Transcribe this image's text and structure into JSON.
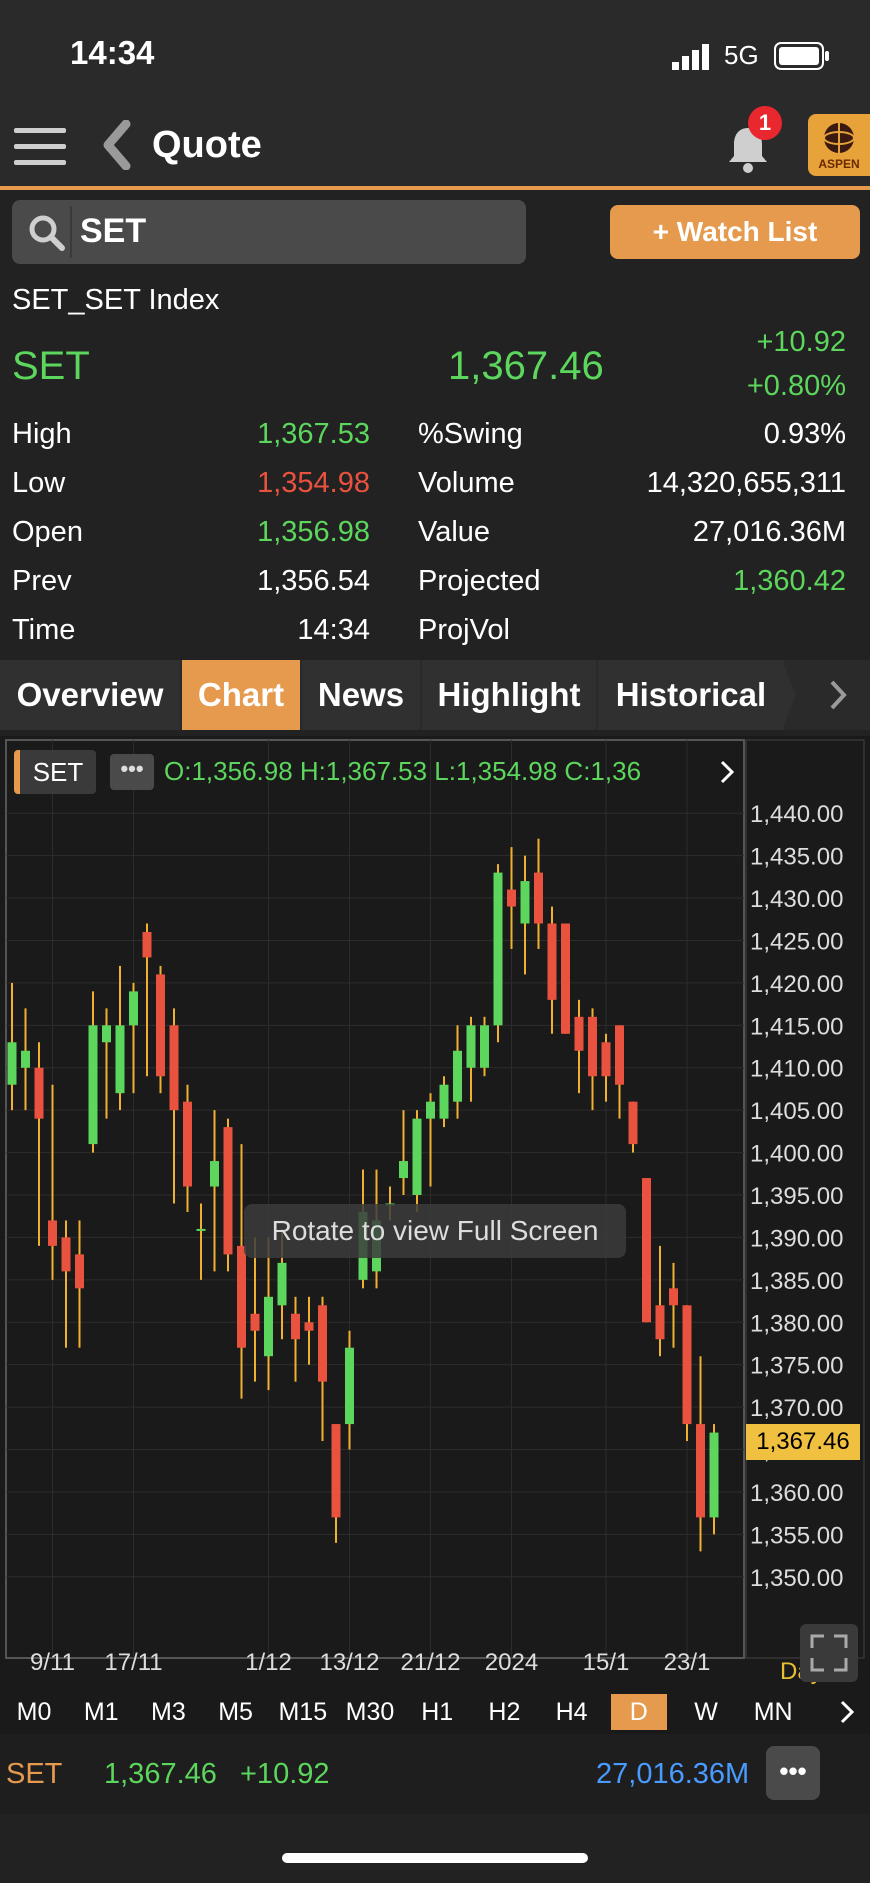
{
  "status_bar": {
    "time": "14:34",
    "network": "5G"
  },
  "header": {
    "title": "Quote",
    "notification_count": "1",
    "logo_text": "ASPEN"
  },
  "search": {
    "value": "SET"
  },
  "watchlist_button": "+ Watch List",
  "quote": {
    "full_name": "SET_SET Index",
    "symbol": "SET",
    "last": "1,367.46",
    "change": "+10.92",
    "change_pct": "+0.80%",
    "fields_left": [
      {
        "label": "High",
        "value": "1,367.53",
        "color": "#5cd65c"
      },
      {
        "label": "Low",
        "value": "1,354.98",
        "color": "#e8523e"
      },
      {
        "label": "Open",
        "value": "1,356.98",
        "color": "#5cd65c"
      },
      {
        "label": "Prev",
        "value": "1,356.54",
        "color": "#ffffff"
      },
      {
        "label": "Time",
        "value": "14:34",
        "color": "#ffffff"
      }
    ],
    "fields_right": [
      {
        "label": "%Swing",
        "value": "0.93%",
        "color": "#ffffff"
      },
      {
        "label": "Volume",
        "value": "14,320,655,311",
        "color": "#ffffff"
      },
      {
        "label": "Value",
        "value": "27,016.36M",
        "color": "#ffffff"
      },
      {
        "label": "Projected",
        "value": "1,360.42",
        "color": "#5cd65c"
      },
      {
        "label": "ProjVol",
        "value": "",
        "color": "#ffffff"
      }
    ]
  },
  "tabs": [
    {
      "label": "Overview",
      "active": false
    },
    {
      "label": "Chart",
      "active": true
    },
    {
      "label": "News",
      "active": false
    },
    {
      "label": "Highlight",
      "active": false
    },
    {
      "label": "Historical",
      "active": false
    }
  ],
  "chart": {
    "symbol_tag": "SET",
    "ohlc_text": "O:1,356.98  H:1,367.53  L:1,354.98  C:1,36",
    "overlay": "Rotate to view Full Screen",
    "period_label": "Day",
    "last_price_label": "1,367.46"
  },
  "chart_data": {
    "type": "candlestick",
    "y_ticks": [
      "1,440.00",
      "1,435.00",
      "1,430.00",
      "1,425.00",
      "1,420.00",
      "1,415.00",
      "1,410.00",
      "1,405.00",
      "1,400.00",
      "1,395.00",
      "1,390.00",
      "1,385.00",
      "1,380.00",
      "1,375.00",
      "1,370.00",
      "1,365.00",
      "1,360.00",
      "1,355.00",
      "1,350.00"
    ],
    "ylim": [
      1347.5,
      1442.5
    ],
    "x_tick_labels": [
      {
        "label": "9/11",
        "index": 3
      },
      {
        "label": "17/11",
        "index": 9
      },
      {
        "label": "1/12",
        "index": 19
      },
      {
        "label": "13/12",
        "index": 25
      },
      {
        "label": "21/12",
        "index": 31
      },
      {
        "label": "2024",
        "index": 37
      },
      {
        "label": "15/1",
        "index": 44
      },
      {
        "label": "23/1",
        "index": 50
      }
    ],
    "candles": [
      {
        "o": 1408,
        "h": 1420,
        "l": 1405,
        "c": 1413
      },
      {
        "o": 1410,
        "h": 1417,
        "l": 1405,
        "c": 1412
      },
      {
        "o": 1410,
        "h": 1413,
        "l": 1389,
        "c": 1404
      },
      {
        "o": 1392,
        "h": 1408,
        "l": 1385,
        "c": 1389
      },
      {
        "o": 1390,
        "h": 1392,
        "l": 1377,
        "c": 1386
      },
      {
        "o": 1388,
        "h": 1392,
        "l": 1377,
        "c": 1384
      },
      {
        "o": 1401,
        "h": 1419,
        "l": 1400,
        "c": 1415
      },
      {
        "o": 1413,
        "h": 1417,
        "l": 1404,
        "c": 1415
      },
      {
        "o": 1407,
        "h": 1422,
        "l": 1405,
        "c": 1415
      },
      {
        "o": 1415,
        "h": 1420,
        "l": 1407,
        "c": 1419
      },
      {
        "o": 1426,
        "h": 1427,
        "l": 1409,
        "c": 1423
      },
      {
        "o": 1421,
        "h": 1422,
        "l": 1407,
        "c": 1409
      },
      {
        "o": 1415,
        "h": 1417,
        "l": 1394,
        "c": 1405
      },
      {
        "o": 1406,
        "h": 1408,
        "l": 1393,
        "c": 1396
      },
      {
        "o": 1391,
        "h": 1394,
        "l": 1385,
        "c": 1391
      },
      {
        "o": 1396,
        "h": 1405,
        "l": 1386,
        "c": 1399
      },
      {
        "o": 1403,
        "h": 1404,
        "l": 1386,
        "c": 1388
      },
      {
        "o": 1389,
        "h": 1401,
        "l": 1371,
        "c": 1377
      },
      {
        "o": 1381,
        "h": 1390,
        "l": 1373,
        "c": 1379
      },
      {
        "o": 1376,
        "h": 1390,
        "l": 1372,
        "c": 1383
      },
      {
        "o": 1382,
        "h": 1391,
        "l": 1378,
        "c": 1387
      },
      {
        "o": 1381,
        "h": 1383,
        "l": 1373,
        "c": 1378
      },
      {
        "o": 1380,
        "h": 1383,
        "l": 1375,
        "c": 1379
      },
      {
        "o": 1382,
        "h": 1383,
        "l": 1366,
        "c": 1373
      },
      {
        "o": 1368,
        "h": 1368,
        "l": 1354,
        "c": 1357
      },
      {
        "o": 1368,
        "h": 1379,
        "l": 1365,
        "c": 1377
      },
      {
        "o": 1385,
        "h": 1398,
        "l": 1384,
        "c": 1393
      },
      {
        "o": 1386,
        "h": 1398,
        "l": 1384,
        "c": 1392
      },
      {
        "o": 1394,
        "h": 1396,
        "l": 1392,
        "c": 1394
      },
      {
        "o": 1397,
        "h": 1405,
        "l": 1395,
        "c": 1399
      },
      {
        "o": 1395,
        "h": 1405,
        "l": 1393,
        "c": 1404
      },
      {
        "o": 1404,
        "h": 1407,
        "l": 1396,
        "c": 1406
      },
      {
        "o": 1404,
        "h": 1409,
        "l": 1403,
        "c": 1408
      },
      {
        "o": 1406,
        "h": 1415,
        "l": 1404,
        "c": 1412
      },
      {
        "o": 1410,
        "h": 1416,
        "l": 1406,
        "c": 1415
      },
      {
        "o": 1410,
        "h": 1416,
        "l": 1409,
        "c": 1415
      },
      {
        "o": 1415,
        "h": 1434,
        "l": 1413,
        "c": 1433
      },
      {
        "o": 1431,
        "h": 1436,
        "l": 1424,
        "c": 1429
      },
      {
        "o": 1427,
        "h": 1435,
        "l": 1421,
        "c": 1432
      },
      {
        "o": 1433,
        "h": 1437,
        "l": 1424,
        "c": 1427
      },
      {
        "o": 1427,
        "h": 1429,
        "l": 1414,
        "c": 1418
      },
      {
        "o": 1427,
        "h": 1427,
        "l": 1414,
        "c": 1414
      },
      {
        "o": 1416,
        "h": 1418,
        "l": 1407,
        "c": 1412
      },
      {
        "o": 1416,
        "h": 1417,
        "l": 1405,
        "c": 1409
      },
      {
        "o": 1413,
        "h": 1414,
        "l": 1406,
        "c": 1409
      },
      {
        "o": 1415,
        "h": 1415,
        "l": 1404,
        "c": 1408
      },
      {
        "o": 1406,
        "h": 1406,
        "l": 1400,
        "c": 1401
      },
      {
        "o": 1397,
        "h": 1397,
        "l": 1380,
        "c": 1380
      },
      {
        "o": 1382,
        "h": 1389,
        "l": 1376,
        "c": 1378
      },
      {
        "o": 1384,
        "h": 1387,
        "l": 1377,
        "c": 1382
      },
      {
        "o": 1382,
        "h": 1382,
        "l": 1366,
        "c": 1368
      },
      {
        "o": 1368,
        "h": 1376,
        "l": 1353,
        "c": 1357
      },
      {
        "o": 1357,
        "h": 1368,
        "l": 1355,
        "c": 1367
      }
    ]
  },
  "timeframes": [
    {
      "label": "M0",
      "active": false
    },
    {
      "label": "M1",
      "active": false
    },
    {
      "label": "M3",
      "active": false
    },
    {
      "label": "M5",
      "active": false
    },
    {
      "label": "M15",
      "active": false
    },
    {
      "label": "M30",
      "active": false
    },
    {
      "label": "H1",
      "active": false
    },
    {
      "label": "H2",
      "active": false
    },
    {
      "label": "H4",
      "active": false
    },
    {
      "label": "D",
      "active": true
    },
    {
      "label": "W",
      "active": false
    },
    {
      "label": "MN",
      "active": false
    }
  ],
  "footer": {
    "symbol": "SET",
    "last": "1,367.46",
    "change": "+10.92",
    "value": "27,016.36M"
  },
  "colors": {
    "accent": "#e59a4e",
    "up": "#5cd65c",
    "down": "#e8523e",
    "footer_value": "#4a9bff"
  }
}
